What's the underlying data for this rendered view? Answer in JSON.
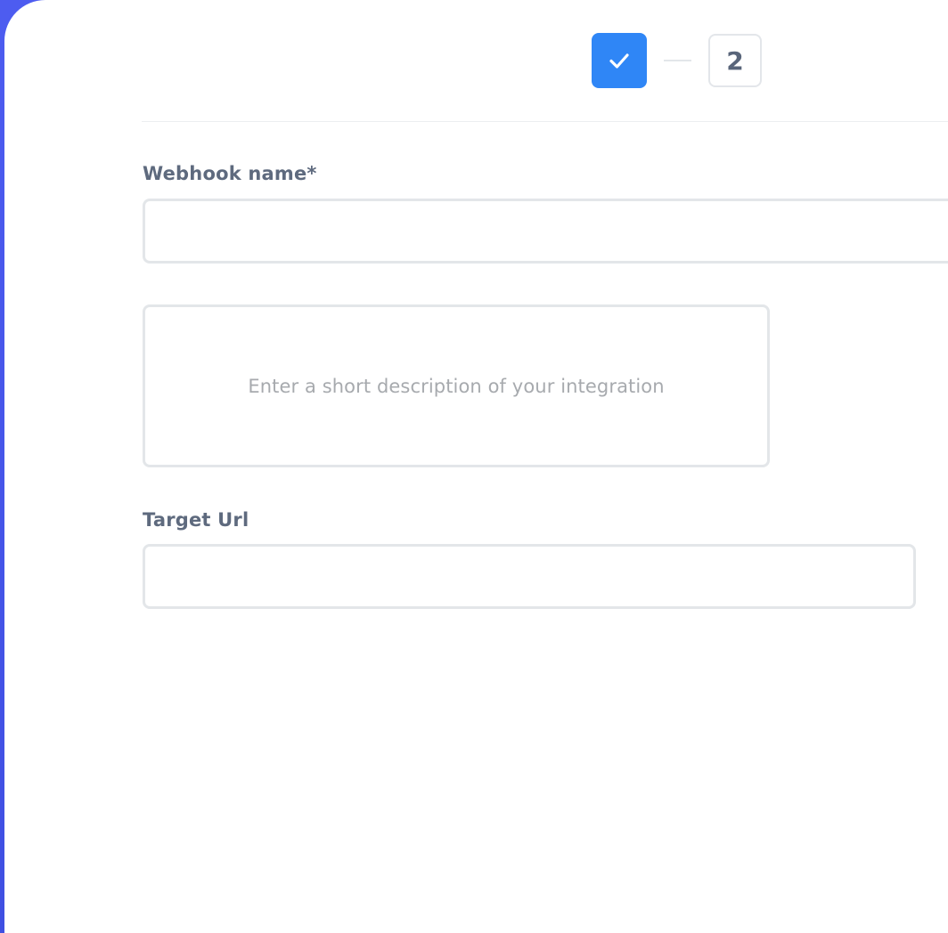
{
  "stepper": {
    "step1": {
      "state": "completed",
      "icon": "check-icon",
      "color": "#2f86f6"
    },
    "step2": {
      "label": "2",
      "state": "current"
    }
  },
  "form": {
    "webhook_name": {
      "label": "Webhook name*",
      "value": "",
      "placeholder": ""
    },
    "description": {
      "value": "",
      "placeholder": "Enter a short description of your integration"
    },
    "target_url": {
      "label": "Target Url",
      "value": "",
      "placeholder": ""
    }
  },
  "colors": {
    "accent": "#2f86f6",
    "background": "#4a5be8",
    "label": "#5e6a7e",
    "placeholder": "#a7aaae",
    "border": "#e3e6e9"
  }
}
